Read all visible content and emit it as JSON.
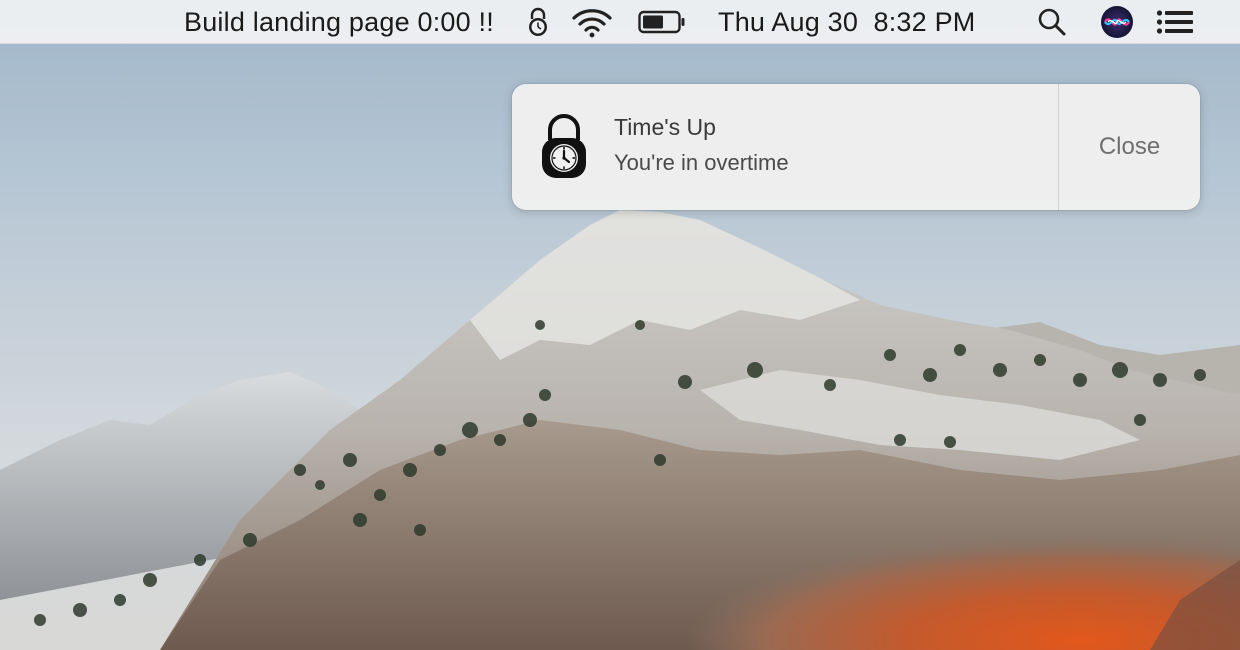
{
  "menubar": {
    "timer_text": "Build landing page 0:00 !!",
    "timer_icon": "lock-clock-icon",
    "wifi_icon": "wifi-icon",
    "battery_icon": "battery-icon",
    "clock_text": "Thu Aug 30  8:32 PM",
    "spotlight_icon": "search-icon",
    "siri_icon": "siri-icon",
    "notification_center_icon": "list-icon"
  },
  "notification": {
    "app_icon": "lock-clock-icon",
    "title": "Time's Up",
    "body": "You're in overtime",
    "close_label": "Close"
  },
  "desktop": {
    "wallpaper": "mountain-wallpaper"
  },
  "colors": {
    "menubar_bg": "#eef0f3",
    "notification_bg": "#f0f0f0",
    "sky": "#b9cbd9",
    "autumn_orange": "#c8592a"
  }
}
